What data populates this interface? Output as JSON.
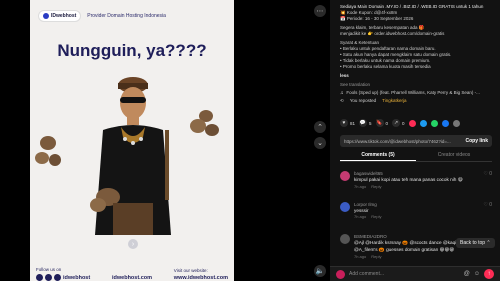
{
  "video": {
    "brand": "IDwebhost",
    "brand_tagline": "Provider Domain Hosting Indonesia",
    "headline": "Nungguin, ya????",
    "follow_label": "Follow us on",
    "follow_handle": "idwebhost",
    "site_label": "idwebhost.com",
    "visit_label": "Visit our website:",
    "visit_url": "www.idwebhost.com"
  },
  "description": {
    "lines": [
      "Sediaya Main Domain .MY.ID / .BIZ.ID / .WEB.ID GRATIS untuk 1 tahun",
      "💥 Kode Kupon: d@4f-xx8m",
      "📅 Periode: 16 - 30 September 2026"
    ],
    "how": [
      "Segera klaim, terbaru kesempatan ada 🎁",
      "menjadikit ke 👉 order.idwebhost.com/domain-gratis"
    ],
    "terms_title": "Syarat & Ketentuan",
    "terms": [
      "• Berlaku untuk pendaftaran nama domain baru.",
      "• Satu akun hanya dapat mengklaim satu domain gratis.",
      "• Tidak berlaku untuk nama domain premium.",
      "• Promo berlaku selama kuota masih tersedia"
    ],
    "less": "less",
    "see_translation": "See translation",
    "music": "Fools (Sped up) (feat. Pharrell Williams, Katy Perry & Big Sean) -...",
    "reposted": "You reposted",
    "tag": "Tingkatkerja"
  },
  "stats": {
    "likes": "81",
    "comments": "5",
    "saves": "0",
    "shares": "0"
  },
  "link": {
    "url": "https://www.tiktok.com/@idwebhost/photo/7462?id=...",
    "copy_label": "Copy link"
  },
  "tabs": [
    {
      "label": "Comments (5)"
    },
    {
      "label": "Creator videos"
    }
  ],
  "comments": [
    {
      "user": "bagaswidelt65",
      "text": "kimpul pakai kopi atau teh mana panas cocok nih 😄",
      "time": "7h ago",
      "reply": "Reply",
      "likes": "0",
      "color": "#c43b72"
    },
    {
      "user": "Lorpor Ilmg",
      "text": "yesssir",
      "time": "7h ago",
      "reply": "Reply",
      "likes": "0",
      "color": "#3b5cc4"
    },
    {
      "user": "BSMEDIA2DRO",
      "text": "@Ajl @Hardik ksrsnay 🎃 @scocts dance @kaqirk",
      "text2": "@A_filem's 🎃 guesses domain gratisan 😁😁😁",
      "time": "7h ago",
      "reply": "Reply",
      "likes": "0",
      "color": "#555"
    }
  ],
  "back_to_top": "Back to top ⌃",
  "add_comment": {
    "placeholder": "Add comment..."
  },
  "colors": {
    "accent": "#fe2c55",
    "panel": "#121212",
    "brand_navy": "#1f1e5a"
  }
}
